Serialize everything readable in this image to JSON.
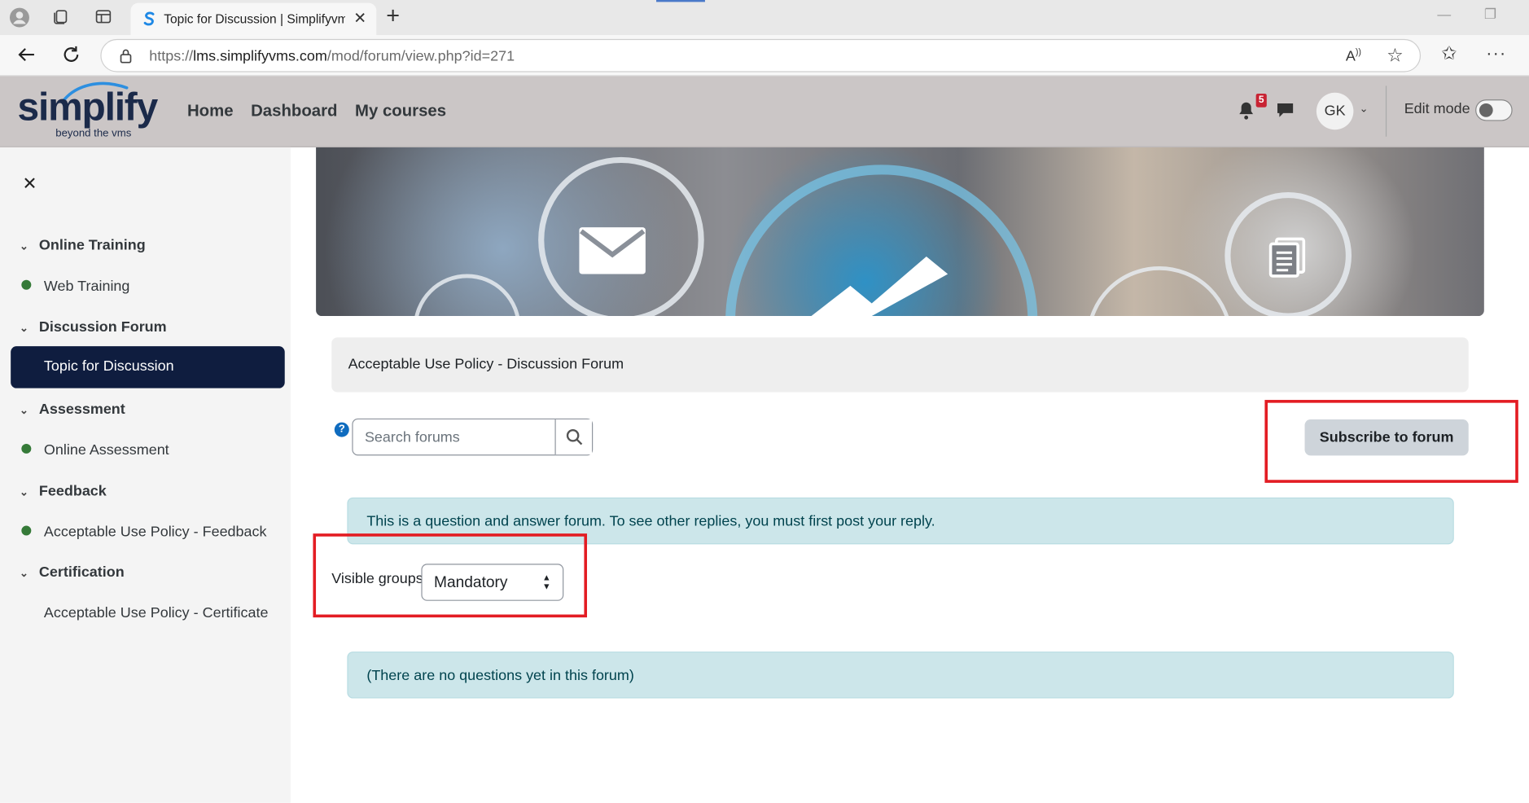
{
  "browser": {
    "tab_title": "Topic for Discussion | Simplifyvms",
    "url_prefix": "https://",
    "url_host": "lms.simplifyvms.com",
    "url_path": "/mod/forum/view.php?id=271"
  },
  "header": {
    "logo_word": "simplify",
    "logo_tagline": "beyond the vms",
    "nav": [
      "Home",
      "Dashboard",
      "My courses"
    ],
    "notification_count": "5",
    "user_initials": "GK",
    "edit_mode_label": "Edit mode",
    "edit_mode_on": false
  },
  "drawer": {
    "sections": [
      {
        "title": "Online Training",
        "items": [
          "Web Training"
        ]
      },
      {
        "title": "Discussion Forum",
        "items": [
          "Topic for Discussion"
        ]
      },
      {
        "title": "Assessment",
        "items": [
          "Online Assessment"
        ]
      },
      {
        "title": "Feedback",
        "items": [
          "Acceptable Use Policy - Feedback"
        ]
      },
      {
        "title": "Certification",
        "items": [
          "Acceptable Use Policy - Certificate"
        ]
      }
    ],
    "active_item": "Topic for Discussion"
  },
  "main": {
    "forum_title": "Acceptable Use Policy - Discussion Forum",
    "search_placeholder": "Search forums",
    "subscribe_label": "Subscribe to forum",
    "qa_notice": "This is a question and answer forum. To see other replies, you must first post your reply.",
    "visible_groups_label": "Visible groups",
    "visible_groups_value": "Mandatory",
    "empty_notice": "(There are no questions yet in this forum)"
  },
  "colors": {
    "header_bg": "#cbc6c6",
    "active_item_bg": "#0f1d3f",
    "alert_bg": "#cce6ea",
    "highlight_red": "#e31c23",
    "status_dot": "#357a38"
  }
}
